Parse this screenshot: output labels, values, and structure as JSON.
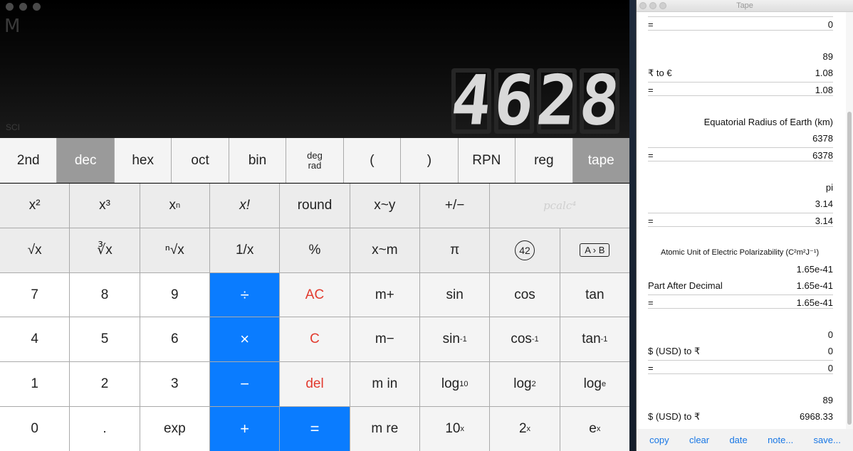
{
  "calculator": {
    "memory_indicator": "M",
    "mode_indicator": "SCI",
    "display_value": "4628",
    "row1": [
      {
        "label": "2nd",
        "name": "2nd-button",
        "style": "light"
      },
      {
        "label": "dec",
        "name": "dec-button",
        "style": "sel"
      },
      {
        "label": "hex",
        "name": "hex-button",
        "style": "light"
      },
      {
        "label": "oct",
        "name": "oct-button",
        "style": "light"
      },
      {
        "label": "bin",
        "name": "bin-button",
        "style": "light"
      },
      {
        "label": "deg",
        "label2": "rad",
        "name": "deg-rad-button",
        "style": "light",
        "type": "degrad"
      },
      {
        "label": "(",
        "name": "open-paren-button",
        "style": "light"
      },
      {
        "label": ")",
        "name": "close-paren-button",
        "style": "light"
      },
      {
        "label": "RPN",
        "name": "rpn-button",
        "style": "light"
      },
      {
        "label": "reg",
        "name": "reg-button",
        "style": "light"
      },
      {
        "label": "tape",
        "name": "tape-button",
        "style": "sel"
      }
    ],
    "row2": {
      "x2": "x²",
      "x3": "x³",
      "xn_base": "x",
      "xn_exp": "n",
      "xfact": "x!",
      "round": "round",
      "xswapy": "x~y",
      "plusminus": "+/−",
      "logo": "pcalc⁴"
    },
    "row3": {
      "sqrt": "√x",
      "cbrt": "∛x",
      "nroot": "ⁿ√x",
      "recip": "1/x",
      "percent": "%",
      "xswapm": "x~m",
      "pi": "π",
      "answer": "42",
      "convert": "A › B"
    },
    "row4": [
      "7",
      "8",
      "9",
      "÷",
      "AC",
      "m+",
      "sin",
      "cos",
      "tan"
    ],
    "row5": [
      "4",
      "5",
      "6",
      "×",
      "C",
      "m−",
      "sin",
      "cos",
      "tan"
    ],
    "row5_sup": "-1",
    "row6": [
      "1",
      "2",
      "3",
      "−",
      "del",
      "m in",
      "log",
      "log",
      "log"
    ],
    "row6_sub": [
      "10",
      "2",
      "e"
    ],
    "row7": [
      "0",
      ".",
      "exp",
      "+",
      "=",
      "m re",
      "10",
      "2",
      "e"
    ],
    "row7_sup": "x"
  },
  "tape": {
    "title": "Tape",
    "lines": [
      {
        "label": "=",
        "value": "0",
        "eq": true
      },
      {
        "label": "",
        "value": "89"
      },
      {
        "label": "₹ to €",
        "value": "1.08"
      },
      {
        "label": "=",
        "value": "1.08",
        "eq": true
      },
      {
        "label": "",
        "value": "Equatorial Radius of Earth (km)"
      },
      {
        "label": "",
        "value": "6378"
      },
      {
        "label": "=",
        "value": "6378",
        "eq": true
      },
      {
        "label": "",
        "value": "pi"
      },
      {
        "label": "",
        "value": "3.14"
      },
      {
        "label": "=",
        "value": "3.14",
        "eq": true
      },
      {
        "label": "Atomic Unit of Electric Polarizability (C²m²J⁻¹)",
        "value": "",
        "small": true
      },
      {
        "label": "",
        "value": "1.65e-41"
      },
      {
        "label": "Part After Decimal",
        "value": "1.65e-41"
      },
      {
        "label": "=",
        "value": "1.65e-41",
        "eq": true
      },
      {
        "label": "",
        "value": "0"
      },
      {
        "label": "$ (USD) to ₹",
        "value": "0"
      },
      {
        "label": "=",
        "value": "0",
        "eq": true
      },
      {
        "label": "",
        "value": "89"
      },
      {
        "label": "$ (USD) to ₹",
        "value": "6968.33"
      }
    ],
    "footer": [
      "copy",
      "clear",
      "date",
      "note...",
      "save..."
    ]
  }
}
